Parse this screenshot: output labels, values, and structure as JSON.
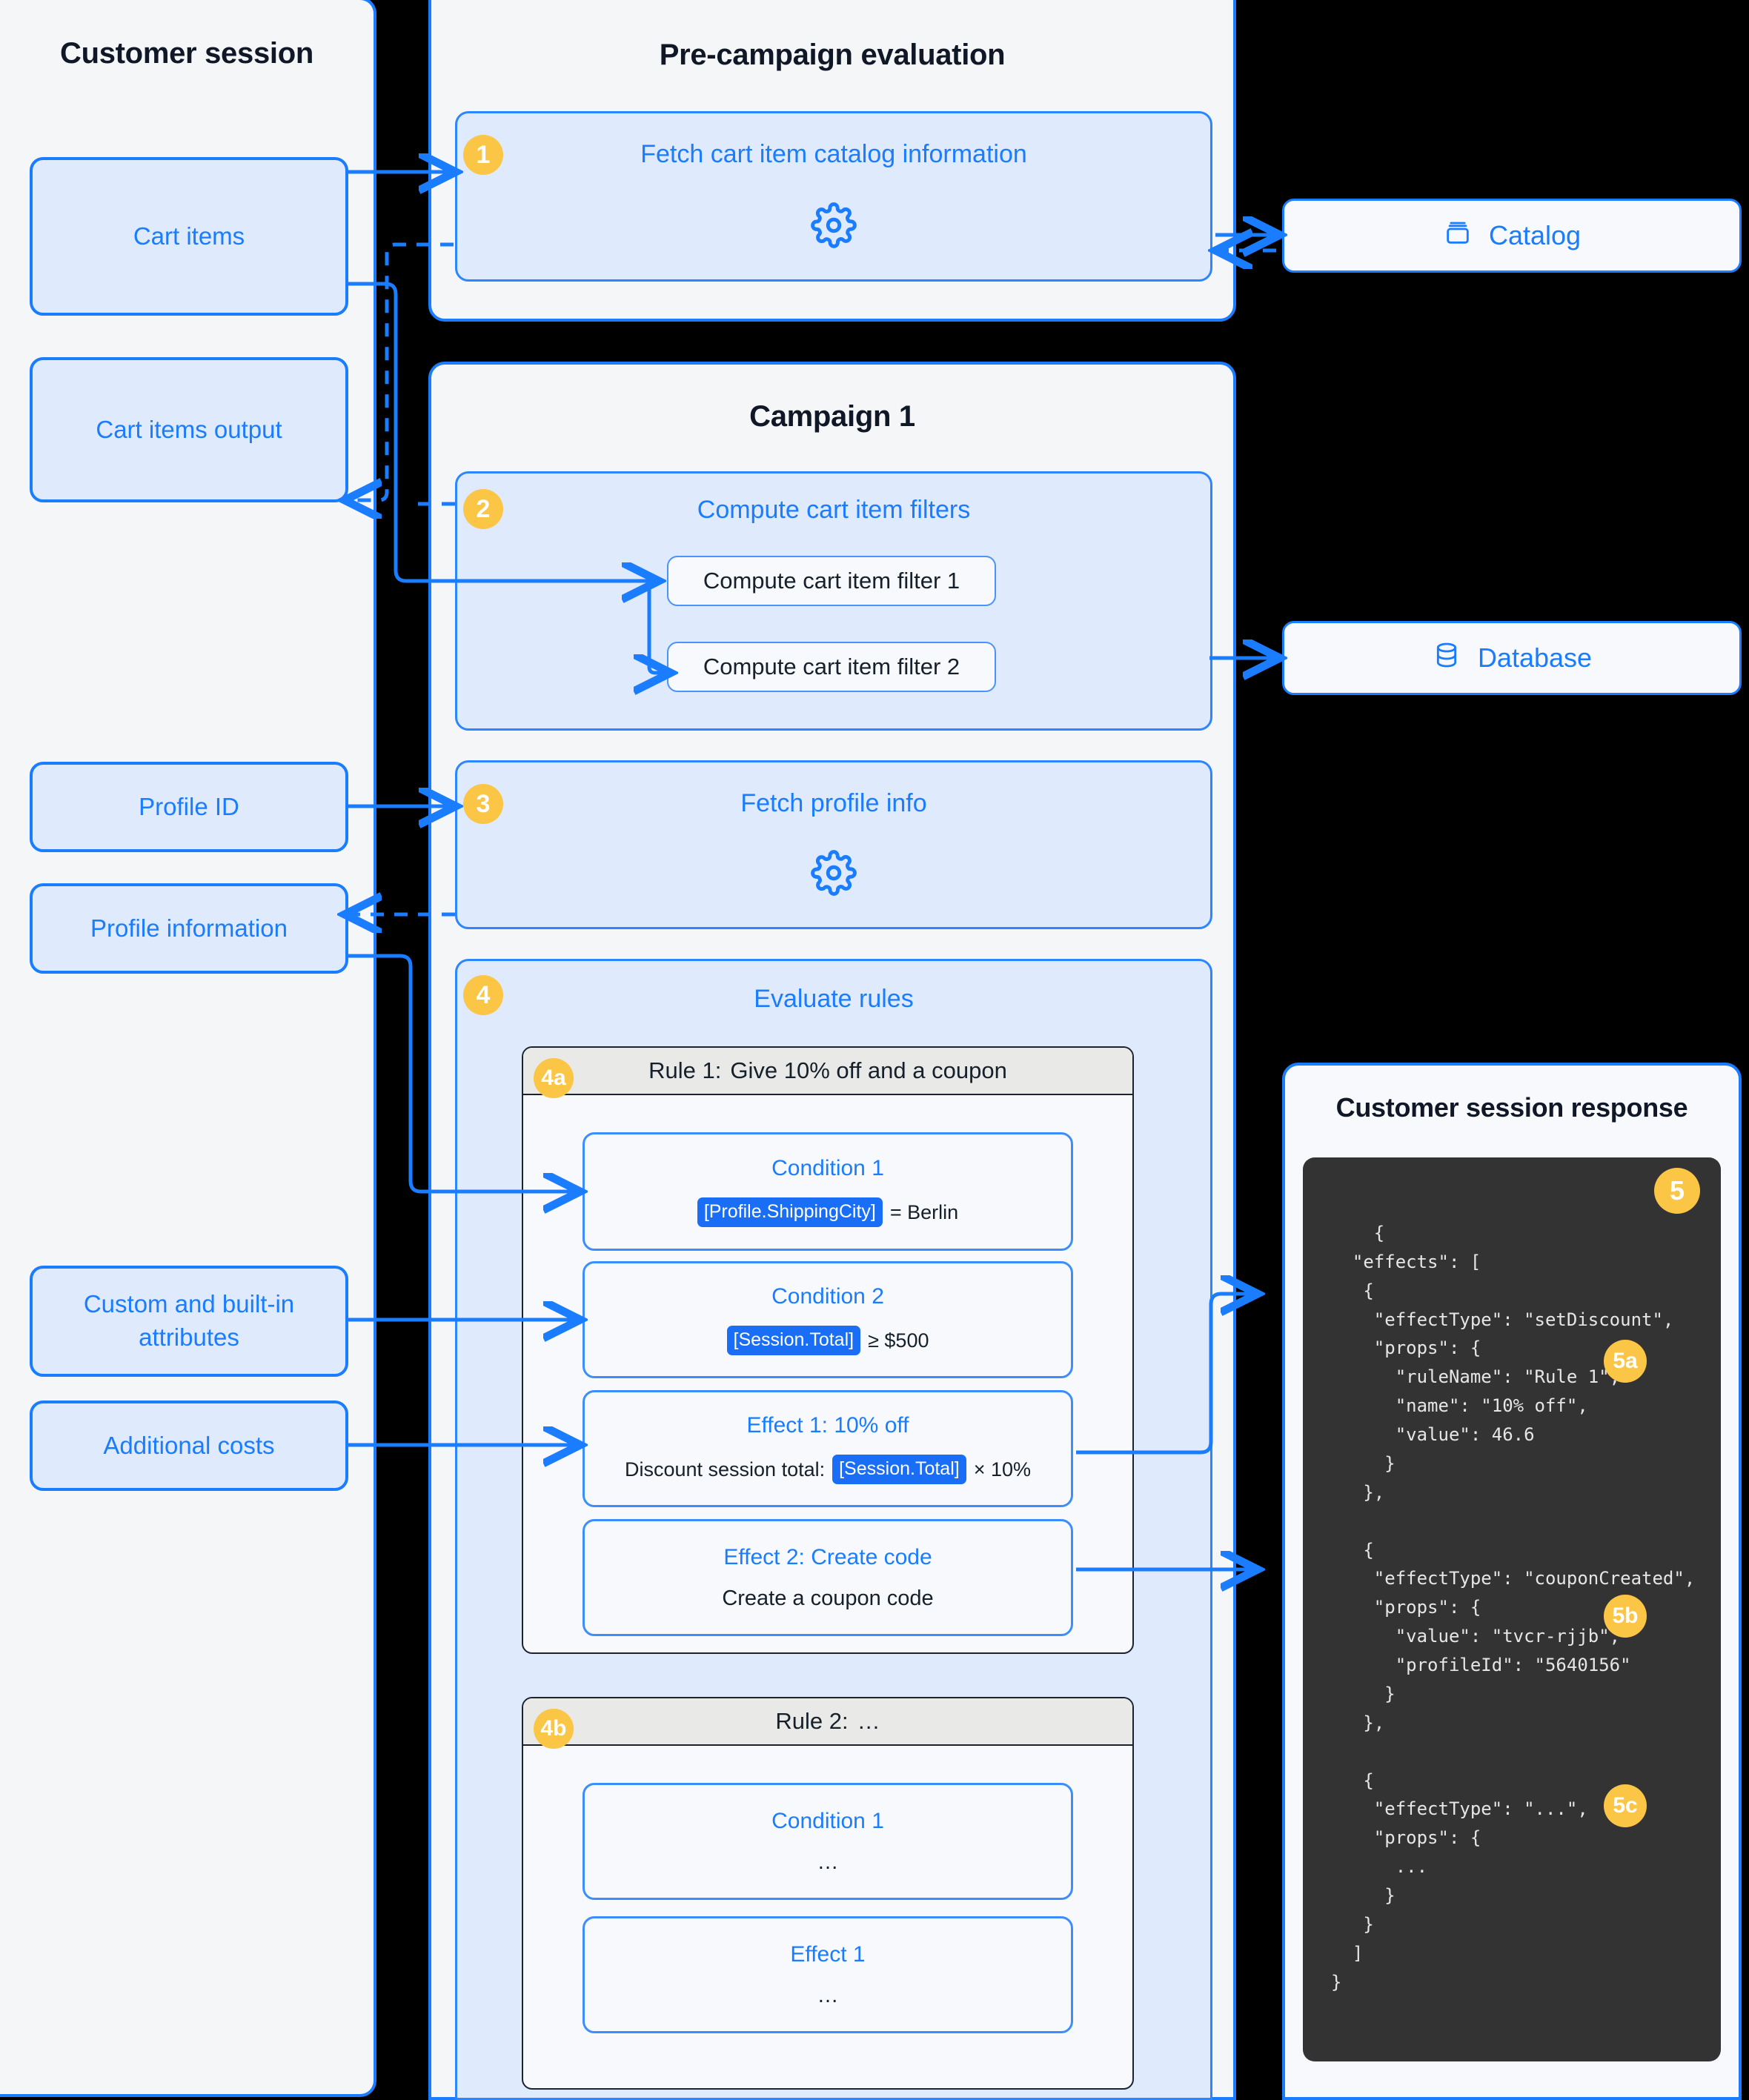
{
  "customer_session": {
    "title": "Customer session",
    "chips": [
      {
        "label": "Cart items"
      },
      {
        "label": "Cart items output"
      },
      {
        "label": "Profile ID"
      },
      {
        "label": "Profile information"
      },
      {
        "label": "Custom and built-in attributes"
      },
      {
        "label": "Additional costs"
      }
    ]
  },
  "pre_campaign": {
    "title": "Pre-campaign evaluation",
    "step": {
      "badge": "1",
      "label": "Fetch cart item catalog information",
      "icon": "gear-icon"
    }
  },
  "campaign": {
    "title": "Campaign 1",
    "compute_filters": {
      "badge": "2",
      "label": "Compute cart item filters",
      "filters": [
        "Compute cart item filter 1",
        "Compute cart item filter 2"
      ]
    },
    "fetch_profile": {
      "badge": "3",
      "label": "Fetch profile info",
      "icon": "gear-icon"
    },
    "evaluate_rules": {
      "badge": "4",
      "label": "Evaluate rules",
      "rules": [
        {
          "badge": "4a",
          "title": "Rule 1:",
          "subtitle": "Give 10% off and a coupon",
          "items": [
            {
              "header": "Condition 1",
              "tag": "[Profile.ShippingCity]",
              "after": "= Berlin"
            },
            {
              "header": "Condition 2",
              "tag": "[Session.Total]",
              "after": "≥ $500"
            },
            {
              "header": "Effect 1: 10% off",
              "before": "Discount session total:",
              "tag": "[Session.Total]",
              "after": "× 10%"
            },
            {
              "header": "Effect 2: Create code",
              "plain": "Create a coupon code"
            }
          ]
        },
        {
          "badge": "4b",
          "title": "Rule 2:",
          "subtitle": "…",
          "items": [
            {
              "header": "Condition 1",
              "plain": "…"
            },
            {
              "header": "Effect 1",
              "plain": "…"
            }
          ]
        }
      ]
    }
  },
  "stores": [
    {
      "label": "Catalog",
      "icon": "catalog-icon"
    },
    {
      "label": "Database",
      "icon": "database-icon"
    }
  ],
  "response": {
    "title": "Customer session response",
    "badges": [
      "5",
      "5a",
      "5b",
      "5c"
    ],
    "code_lines": [
      "{",
      "  \"effects\": [",
      "   {",
      "    \"effectType\": \"setDiscount\",",
      "    \"props\": {",
      "      \"ruleName\": \"Rule 1\",",
      "      \"name\": \"10% off\",",
      "      \"value\": 46.6",
      "     }",
      "   },",
      "",
      "   {",
      "    \"effectType\": \"couponCreated\",",
      "    \"props\": {",
      "      \"value\": \"tvcr-rjjb\",",
      "      \"profileId\": \"5640156\"",
      "     }",
      "   },",
      "",
      "   {",
      "    \"effectType\": \"...\",",
      "    \"props\": {",
      "      ...",
      "     }",
      "   }",
      "  ]",
      "}"
    ]
  },
  "colors": {
    "accent": "#1a7cff",
    "chip_fill": "#dfeafd",
    "badge": "#fbc545",
    "panel_fill": "#f5f6f7",
    "code_bg": "#333333",
    "tag_fill": "#1a6ef5"
  }
}
